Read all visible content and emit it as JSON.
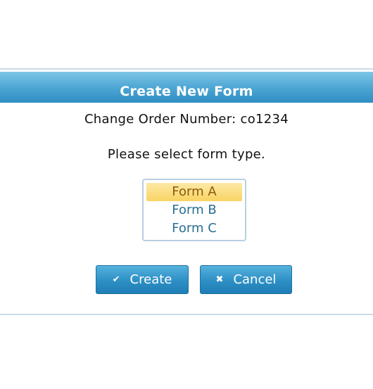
{
  "dialog": {
    "title": "Create New Form",
    "order_label": "Change Order Number: co1234",
    "prompt": "Please select form type.",
    "form_types": {
      "options": [
        "Form A",
        "Form B",
        "Form C"
      ],
      "selected": "Form A"
    },
    "buttons": {
      "create_label": "Create",
      "create_icon": "checkmark-icon",
      "cancel_label": "Cancel",
      "cancel_icon": "close-icon"
    }
  },
  "colors": {
    "title_bar": "#4ea7d4",
    "button": "#2d8fc4",
    "selected_option": "#f9d463",
    "option_text": "#2a6e94"
  }
}
